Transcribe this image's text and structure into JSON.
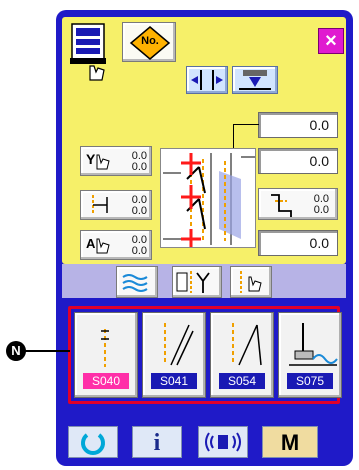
{
  "header": {
    "no_label": "No.",
    "close_label": "×"
  },
  "fields": {
    "top_value": "0.0",
    "right_top_value": "0.0",
    "right_middle_value_a": "0.0",
    "right_middle_value_b": "0.0",
    "right_bottom_value": "0.0",
    "left_top_value_a": "0.0",
    "left_top_value_b": "0.0",
    "left_middle_value_a": "0.0",
    "left_middle_value_b": "0.0",
    "left_bottom_value_a": "0.0",
    "left_bottom_value_b": "0.0"
  },
  "patterns": [
    {
      "code": "S040",
      "selected": true
    },
    {
      "code": "S041",
      "selected": false
    },
    {
      "code": "S054",
      "selected": false
    },
    {
      "code": "S075",
      "selected": false
    }
  ],
  "callout": {
    "label": "N"
  },
  "bottom_bar": {
    "info_label": "i",
    "m_label": "M"
  },
  "colors": {
    "panel_blue": "#1f1ac8",
    "yellow_bg": "#f6f069",
    "lilac_bg": "#b7b3e6",
    "selection_red": "#e0002a",
    "close_magenta": "#e01ad0",
    "pink_label": "#ff2fa8",
    "reset_cyan": "#00a8d8",
    "m_gold": "#e0c480"
  }
}
